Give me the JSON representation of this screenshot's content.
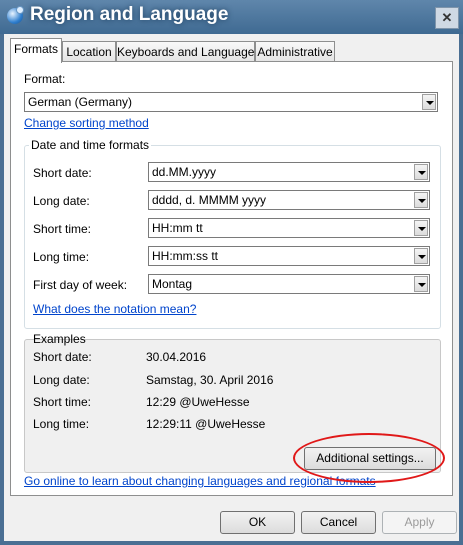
{
  "window": {
    "title": "Region and Language",
    "close_glyph": "✕"
  },
  "tabs": [
    {
      "label": "Formats",
      "active": true
    },
    {
      "label": "Location",
      "active": false
    },
    {
      "label": "Keyboards and Languages",
      "active": false
    },
    {
      "label": "Administrative",
      "active": false
    }
  ],
  "format": {
    "label": "Format:",
    "value": "German (Germany)",
    "sorting_link": "Change sorting method"
  },
  "datetime": {
    "group_title": "Date and time formats",
    "rows": [
      {
        "label": "Short date:",
        "value": "dd.MM.yyyy"
      },
      {
        "label": "Long date:",
        "value": "dddd, d. MMMM yyyy"
      },
      {
        "label": "Short time:",
        "value": "HH:mm tt"
      },
      {
        "label": "Long time:",
        "value": "HH:mm:ss tt"
      },
      {
        "label": "First day of week:",
        "value": "Montag"
      }
    ],
    "notation_link": "What does the notation mean?"
  },
  "examples": {
    "title": "Examples",
    "rows": [
      {
        "label": "Short date:",
        "value": "30.04.2016"
      },
      {
        "label": "Long date:",
        "value": "Samstag, 30. April 2016"
      },
      {
        "label": "Short time:",
        "value": "12:29 @UweHesse"
      },
      {
        "label": "Long time:",
        "value": "12:29:11 @UweHesse"
      }
    ]
  },
  "additional_button": "Additional settings...",
  "online_link": "Go online to learn about changing languages and regional formats",
  "footer": {
    "ok": "OK",
    "cancel": "Cancel",
    "apply": "Apply"
  },
  "colors": {
    "title_bar": "#4a6f93",
    "link": "#0044cc",
    "highlight": "#e01818"
  }
}
